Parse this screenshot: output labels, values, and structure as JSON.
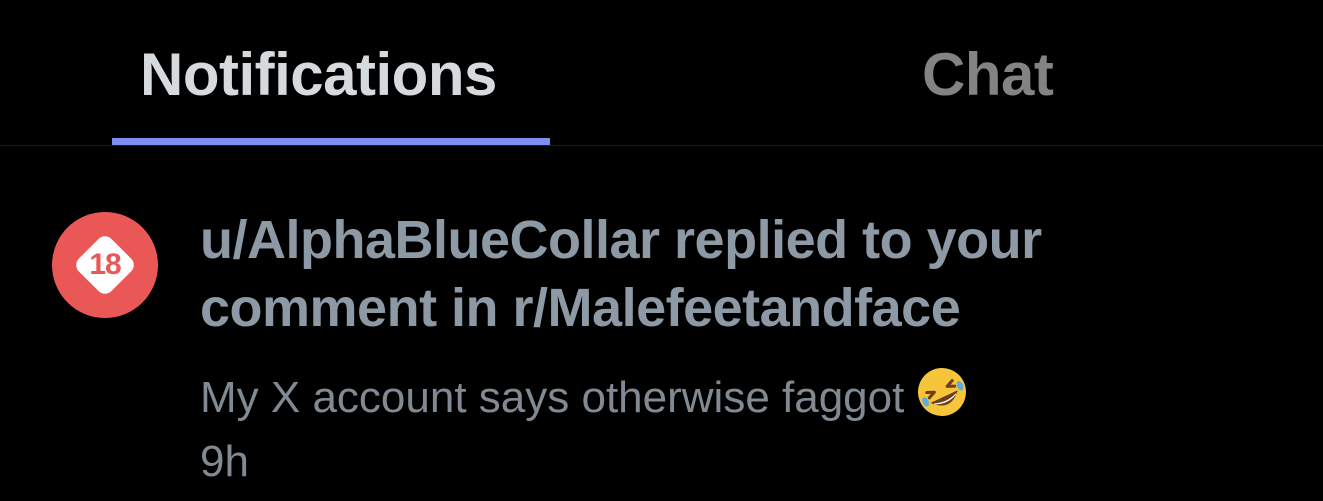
{
  "tabs": {
    "notifications_label": "Notifications",
    "chat_label": "Chat",
    "active": "notifications",
    "indicator_color": "#7d8df0"
  },
  "notification": {
    "icon": "nsfw-18-icon",
    "icon_badge": "18",
    "icon_color": "#ea5757",
    "title_line1": "u/AlphaBlueCollar replied to your",
    "title_line2": "comment in r/Malefeetandface",
    "body": "My X account says otherwise faggot",
    "body_emoji": "rolling-on-the-floor-laughing-emoji",
    "time": "9h"
  }
}
